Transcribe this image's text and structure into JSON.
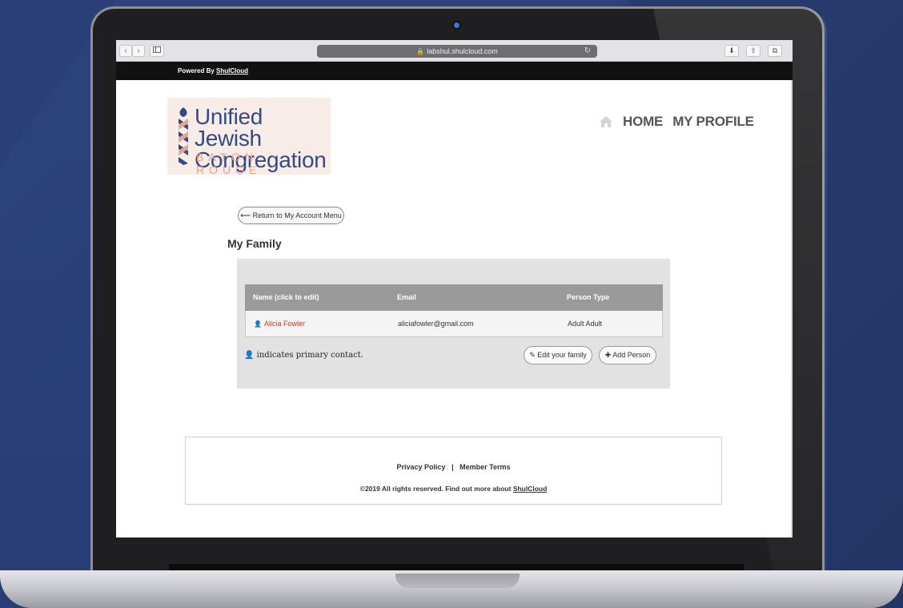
{
  "browser": {
    "url": "labshul.shulcloud.com",
    "back_glyph": "‹",
    "forward_glyph": "›"
  },
  "powered_bar": {
    "prefix": "Powered By",
    "link": "ShulCloud"
  },
  "logo": {
    "line1": "Unified Jewish",
    "line2": "Congregation",
    "line3": "BATON ROUGE",
    "colors": {
      "primary": "#344a86",
      "accent": "#e8a48c"
    }
  },
  "nav": {
    "home": "HOME",
    "profile": "MY PROFILE"
  },
  "return_button": "Return to My Account Menu",
  "page_title": "My Family",
  "table": {
    "headers": [
      "Name (click to edit)",
      "Email",
      "Person Type"
    ],
    "rows": [
      {
        "name": "Alicia Fowler",
        "email": "aliciafowler@gmail.com",
        "type": "Adult Adult"
      }
    ]
  },
  "primary_note": "indicates primary contact.",
  "buttons": {
    "edit_family": "Edit your family",
    "add_person": "Add Person"
  },
  "footer": {
    "privacy": "Privacy Policy",
    "separator": "|",
    "terms": "Member Terms",
    "copyright": "©2019 All rights reserved. Find out more about",
    "link": "ShulCloud"
  }
}
